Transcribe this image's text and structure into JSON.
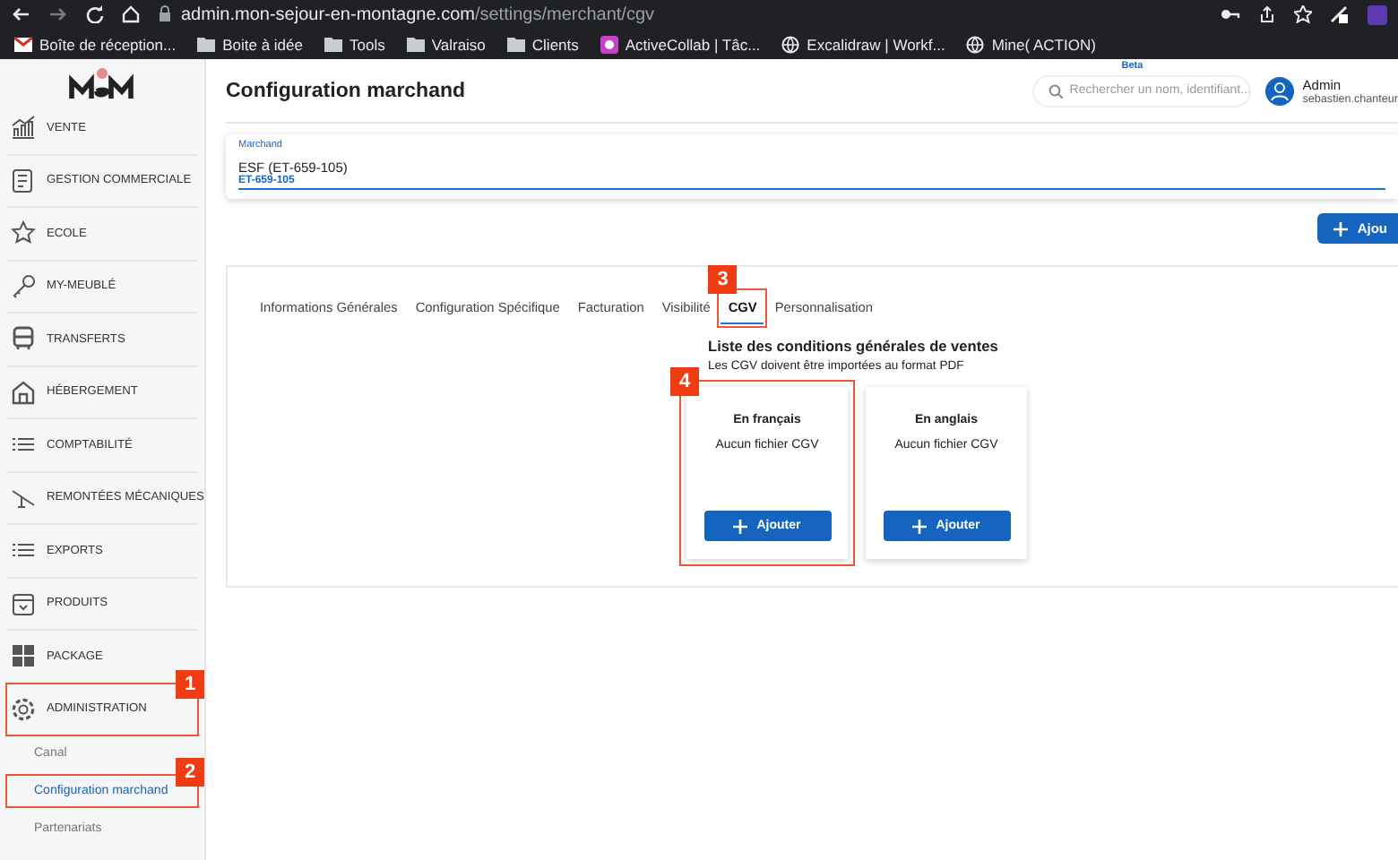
{
  "browser": {
    "url_host": "admin.mon-sejour-en-montagne.com",
    "url_path": "/settings/merchant/cgv",
    "bookmarks": [
      {
        "kind": "mail",
        "label": "Boîte de réception..."
      },
      {
        "kind": "folder",
        "label": "Boite à idée"
      },
      {
        "kind": "folder",
        "label": "Tools"
      },
      {
        "kind": "folder",
        "label": "Valraiso"
      },
      {
        "kind": "folder",
        "label": "Clients"
      },
      {
        "kind": "app",
        "label": "ActiveCollab | Tâc..."
      },
      {
        "kind": "globe",
        "label": "Excalidraw | Workf..."
      },
      {
        "kind": "globe",
        "label": "Mine( ACTION)"
      }
    ]
  },
  "sidebar": {
    "items": [
      {
        "label": "VENTE",
        "expanded": false
      },
      {
        "label": "GESTION COMMERCIALE",
        "expanded": false
      },
      {
        "label": "ECOLE",
        "expanded": false
      },
      {
        "label": "MY-MEUBLÉ",
        "expanded": false
      },
      {
        "label": "TRANSFERTS",
        "expanded": false
      },
      {
        "label": "HÉBERGEMENT",
        "expanded": false
      },
      {
        "label": "COMPTABILITÉ",
        "expanded": false
      },
      {
        "label": "REMONTÉES MÉCANIQUES",
        "expanded": false
      },
      {
        "label": "EXPORTS",
        "expanded": false
      },
      {
        "label": "PRODUITS",
        "expanded": false
      },
      {
        "label": "PACKAGE",
        "expanded": false
      },
      {
        "label": "ADMINISTRATION",
        "expanded": true,
        "callout": "1",
        "children": [
          {
            "label": "Canal",
            "selected": false
          },
          {
            "label": "Configuration marchand",
            "selected": true,
            "callout": "2"
          },
          {
            "label": "Partenariats",
            "selected": false
          }
        ]
      }
    ]
  },
  "header": {
    "title": "Configuration marchand",
    "search": {
      "badge": "Beta",
      "placeholder": "Rechercher un nom, identifiant..."
    },
    "user": {
      "name": "Admin",
      "email": "sebastien.chanteur"
    }
  },
  "merchant_field": {
    "label": "Marchand",
    "value": "ESF (ET-659-105)",
    "code": "ET-659-105"
  },
  "add_button": "Ajou",
  "tabs": [
    {
      "label": "Informations Générales",
      "selected": false
    },
    {
      "label": "Configuration Spécifique",
      "selected": false
    },
    {
      "label": "Facturation",
      "selected": false
    },
    {
      "label": "Visibilité",
      "selected": false
    },
    {
      "label": "CGV",
      "selected": true,
      "callout": "3"
    },
    {
      "label": "Personnalisation",
      "selected": false
    }
  ],
  "cgv": {
    "title": "Liste des conditions générales de ventes",
    "subtitle": "Les CGV doivent être importées au format PDF",
    "cards": [
      {
        "title": "En français",
        "status": "Aucun fichier CGV",
        "button": "Ajouter",
        "callout": "4"
      },
      {
        "title": "En anglais",
        "status": "Aucun fichier CGV",
        "button": "Ajouter"
      }
    ]
  }
}
